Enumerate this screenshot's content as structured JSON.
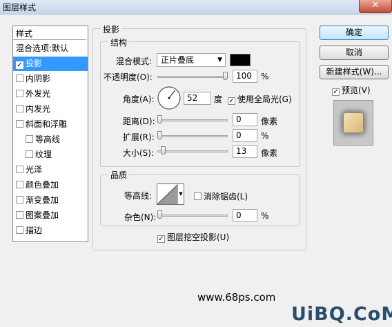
{
  "window": {
    "title": "图层样式",
    "close_glyph": "✕"
  },
  "sidebar": {
    "header": "样式",
    "items": [
      {
        "label": "混合选项:默认",
        "checkbox": false,
        "checked": false,
        "selected": false,
        "indent": false
      },
      {
        "label": "投影",
        "checkbox": true,
        "checked": true,
        "selected": true,
        "indent": false
      },
      {
        "label": "内阴影",
        "checkbox": true,
        "checked": false,
        "selected": false,
        "indent": false
      },
      {
        "label": "外发光",
        "checkbox": true,
        "checked": false,
        "selected": false,
        "indent": false
      },
      {
        "label": "内发光",
        "checkbox": true,
        "checked": false,
        "selected": false,
        "indent": false
      },
      {
        "label": "斜面和浮雕",
        "checkbox": true,
        "checked": false,
        "selected": false,
        "indent": false
      },
      {
        "label": "等高线",
        "checkbox": true,
        "checked": false,
        "selected": false,
        "indent": true
      },
      {
        "label": "纹理",
        "checkbox": true,
        "checked": false,
        "selected": false,
        "indent": true
      },
      {
        "label": "光泽",
        "checkbox": true,
        "checked": false,
        "selected": false,
        "indent": false
      },
      {
        "label": "颜色叠加",
        "checkbox": true,
        "checked": false,
        "selected": false,
        "indent": false
      },
      {
        "label": "渐变叠加",
        "checkbox": true,
        "checked": false,
        "selected": false,
        "indent": false
      },
      {
        "label": "图案叠加",
        "checkbox": true,
        "checked": false,
        "selected": false,
        "indent": false
      },
      {
        "label": "描边",
        "checkbox": true,
        "checked": false,
        "selected": false,
        "indent": false
      }
    ]
  },
  "shadow": {
    "group_title": "投影",
    "structure": {
      "title": "结构",
      "blend_mode_label": "混合模式:",
      "blend_mode_value": "正片叠底",
      "blend_color": "#000000",
      "opacity_label": "不透明度(O):",
      "opacity_value": "100",
      "opacity_unit": "%",
      "opacity_fraction": 1.0,
      "angle_label": "角度(A):",
      "angle_value": "52",
      "angle_unit": "度",
      "global_light_label": "使用全局光(G)",
      "global_light_checked": true,
      "distance_label": "距离(D):",
      "distance_value": "0",
      "distance_unit": "像素",
      "distance_fraction": 0.0,
      "spread_label": "扩展(R):",
      "spread_value": "0",
      "spread_unit": "%",
      "spread_fraction": 0.0,
      "size_label": "大小(S):",
      "size_value": "13",
      "size_unit": "像素",
      "size_fraction": 0.05
    },
    "quality": {
      "title": "品质",
      "contour_label": "等高线:",
      "antialias_label": "消除锯齿(L)",
      "antialias_checked": false,
      "noise_label": "杂色(N):",
      "noise_value": "0",
      "noise_unit": "%",
      "noise_fraction": 0.0
    },
    "knockout_label": "图层挖空投影(U)",
    "knockout_checked": true
  },
  "buttons": {
    "ok": "确定",
    "cancel": "取消",
    "new_style": "新建样式(W)..."
  },
  "preview": {
    "label": "预览(V)",
    "checked": true
  },
  "watermarks": {
    "site": "www.68ps.com",
    "brand": "UiBQ.CoM"
  }
}
